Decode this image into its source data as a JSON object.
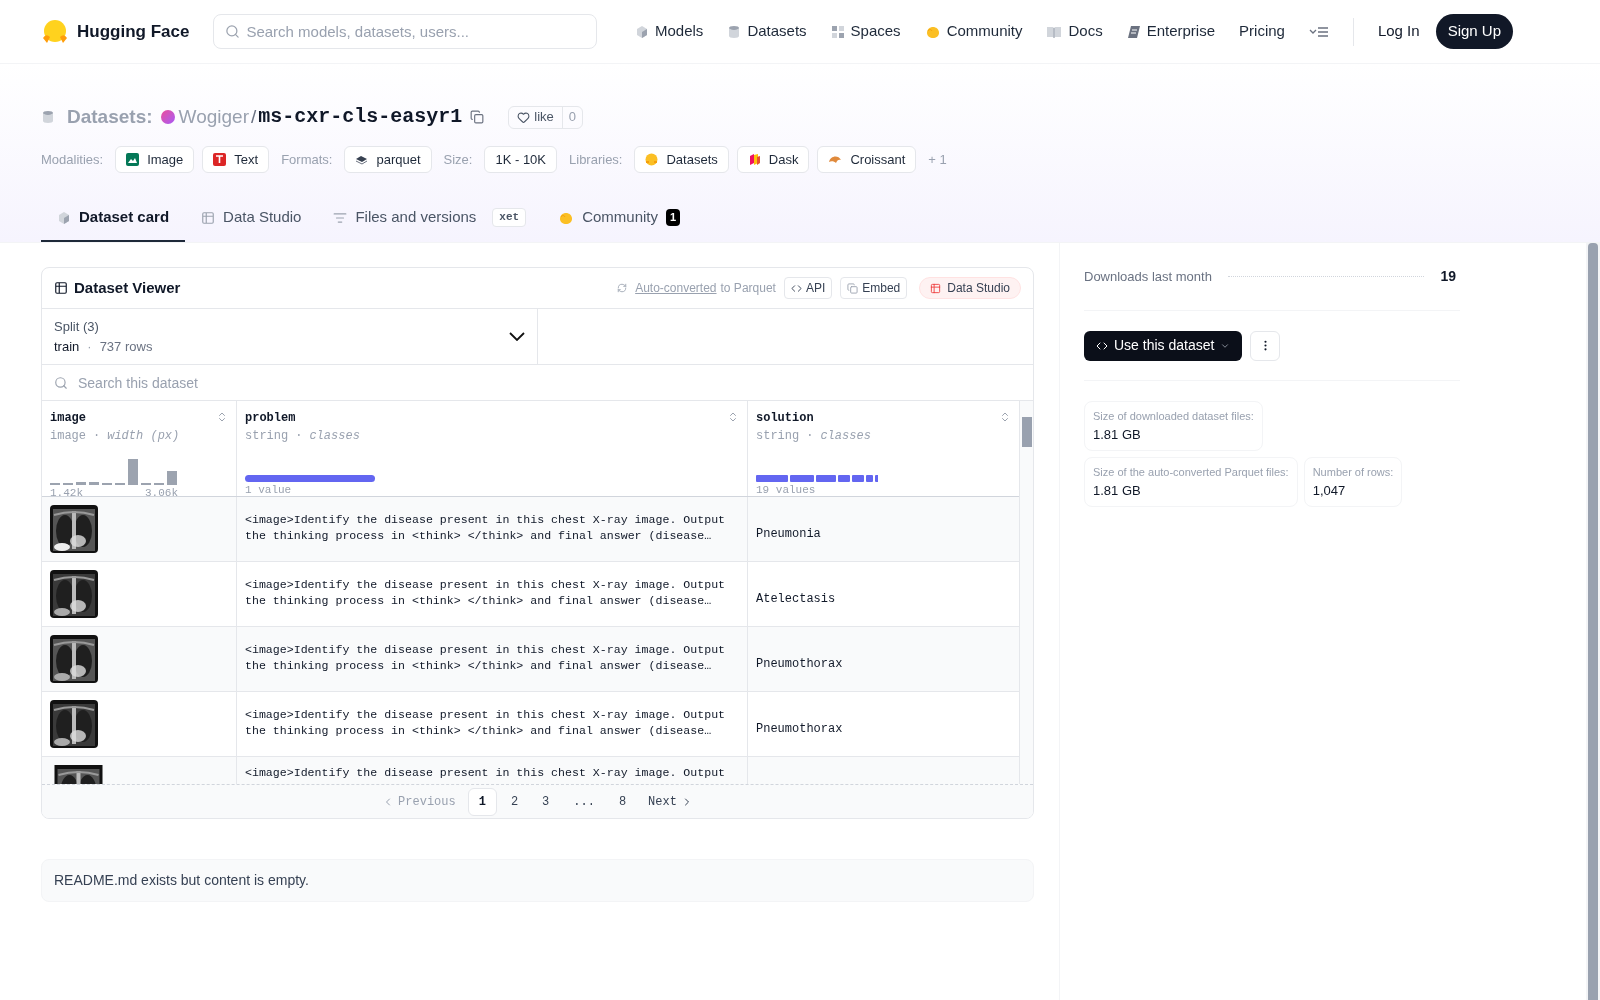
{
  "nav": {
    "brand": "Hugging Face",
    "search": {
      "placeholder": "Search models, datasets, users..."
    },
    "links": [
      {
        "label": "Models"
      },
      {
        "label": "Datasets"
      },
      {
        "label": "Spaces"
      },
      {
        "label": "Community"
      },
      {
        "label": "Docs"
      },
      {
        "label": "Enterprise"
      },
      {
        "label": "Pricing"
      }
    ],
    "login": "Log In",
    "signup": "Sign Up"
  },
  "header": {
    "section": "Datasets:",
    "owner": "Wogiger",
    "separator": "/",
    "name": "ms-cxr-cls-easyr1",
    "like": "like",
    "likes": "0",
    "tag_groups": [
      {
        "label": "Modalities:",
        "items": [
          {
            "label": "Image"
          },
          {
            "label": "Text"
          }
        ]
      },
      {
        "label": "Formats:",
        "items": [
          {
            "label": "parquet"
          }
        ]
      },
      {
        "label": "Size:",
        "items": [
          {
            "label": "1K - 10K"
          }
        ]
      },
      {
        "label": "Libraries:",
        "items": [
          {
            "label": "Datasets"
          },
          {
            "label": "Dask"
          },
          {
            "label": "Croissant"
          }
        ]
      }
    ],
    "more": "+ 1"
  },
  "tabs": [
    {
      "label": "Dataset card",
      "selected": true
    },
    {
      "label": "Data Studio",
      "selected": false
    },
    {
      "label": "Files and versions",
      "selected": false,
      "badge": "xet"
    },
    {
      "label": "Community",
      "selected": false,
      "count": "1"
    }
  ],
  "viewer": {
    "title": "Dataset Viewer",
    "converted_link": "Auto-converted",
    "converted_rest": "to Parquet",
    "actions": [
      {
        "label": "API",
        "kind": "api"
      },
      {
        "label": "Embed",
        "kind": "embed"
      },
      {
        "label": "Data Studio",
        "kind": "studio"
      }
    ],
    "split": {
      "label": "Split (3)",
      "value": "train",
      "sep": "·",
      "rows": "737 rows"
    },
    "search": {
      "placeholder": "Search this dataset"
    },
    "columns": [
      {
        "name": "image",
        "type": "image",
        "dot": "·",
        "stat": "width (px)",
        "kind": "histogram",
        "min": "1.42k",
        "max": "3.06k"
      },
      {
        "name": "problem",
        "type": "string",
        "dot": "·",
        "stat": "classes",
        "kind": "single",
        "summary": "1 value"
      },
      {
        "name": "solution",
        "type": "string",
        "dot": "·",
        "stat": "classes",
        "kind": "multi",
        "summary": "19 values"
      }
    ],
    "rows": [
      {
        "problem": "<image>Identify the disease present in this chest X-ray image. Output the thinking process in <think> </think> and final answer (disease…",
        "solution": "Pneumonia"
      },
      {
        "problem": "<image>Identify the disease present in this chest X-ray image. Output the thinking process in <think> </think> and final answer (disease…",
        "solution": "Atelectasis"
      },
      {
        "problem": "<image>Identify the disease present in this chest X-ray image. Output the thinking process in <think> </think> and final answer (disease…",
        "solution": "Pneumothorax"
      },
      {
        "problem": "<image>Identify the disease present in this chest X-ray image. Output the thinking process in <think> </think> and final answer (disease…",
        "solution": "Pneumothorax"
      },
      {
        "problem": "<image>Identify the disease present in this chest X-ray image. Output"
      }
    ],
    "pagination": {
      "previous": "Previous",
      "next": "Next",
      "pages": [
        {
          "label": "1",
          "selected": true
        },
        {
          "label": "2",
          "selected": false
        },
        {
          "label": "3",
          "selected": false
        },
        {
          "label": "...",
          "selected": false
        },
        {
          "label": "8",
          "selected": false
        }
      ]
    }
  },
  "readme": "README.md exists but content is empty.",
  "sidebar": {
    "downloads_label": "Downloads last month",
    "downloads": "19",
    "use_button": "Use this dataset",
    "stats": [
      {
        "label": "Size of downloaded dataset files:",
        "value": "1.81 GB"
      },
      {
        "label": "Size of the auto-converted Parquet files:",
        "value": "1.81 GB"
      },
      {
        "label": "Number of rows:",
        "value": "1,047"
      }
    ]
  }
}
